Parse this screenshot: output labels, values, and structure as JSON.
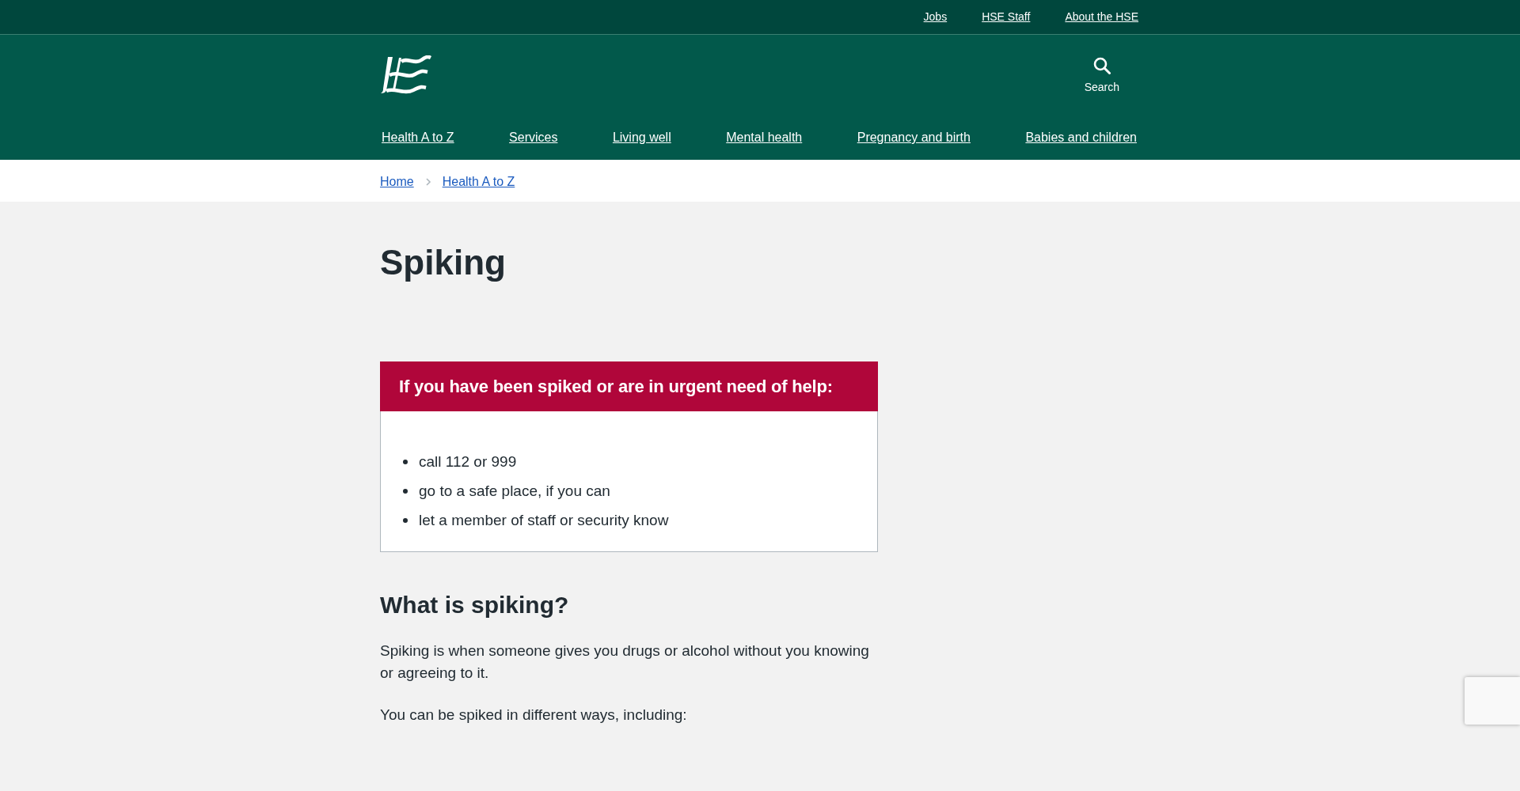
{
  "top_links": [
    "Jobs",
    "HSE Staff",
    "About the HSE"
  ],
  "header": {
    "search_label": "Search"
  },
  "nav": [
    "Health A to Z",
    "Services",
    "Living well",
    "Mental health",
    "Pregnancy and birth",
    "Babies and children"
  ],
  "breadcrumb": [
    "Home",
    "Health A to Z"
  ],
  "title": "Spiking",
  "urgent_box": {
    "heading": "If you have been spiked or are in urgent need of help:",
    "items": [
      "call 112 or 999",
      "go to a safe place, if you can",
      "let a member of staff or security know"
    ]
  },
  "sections": [
    {
      "heading": "What is spiking?",
      "paragraphs": [
        "Spiking is when someone gives you drugs or alcohol without you knowing or agreeing to it.",
        "You can be spiked in different ways, including:"
      ]
    }
  ]
}
